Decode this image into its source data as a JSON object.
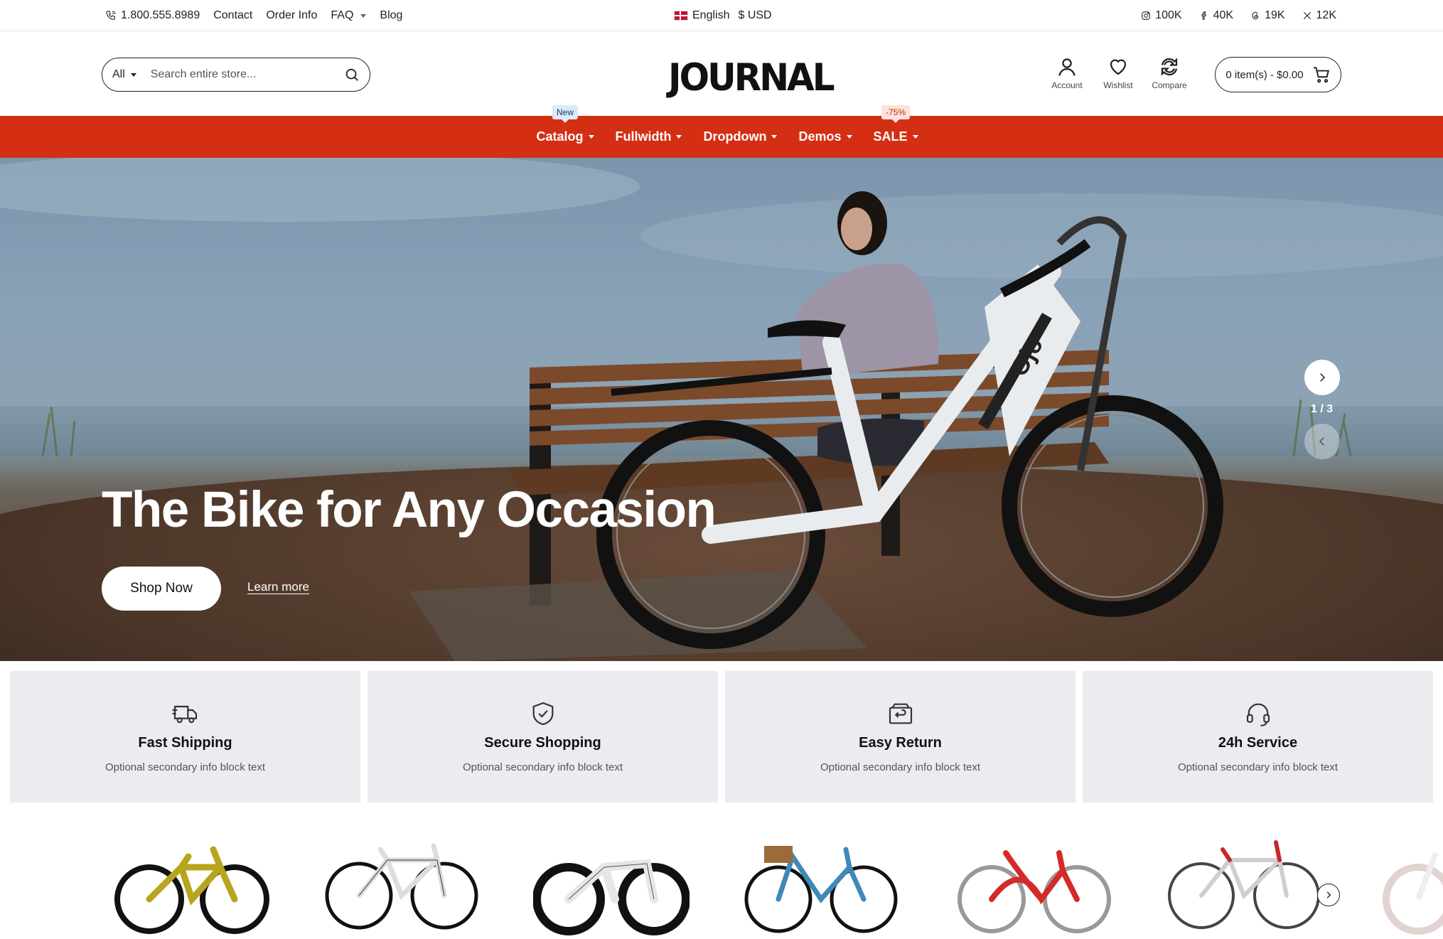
{
  "topbar": {
    "phone": "1.800.555.8989",
    "links": [
      "Contact",
      "Order Info",
      "FAQ",
      "Blog"
    ],
    "language": "English",
    "currency": "$ USD",
    "social": {
      "instagram": "100K",
      "facebook": "40K",
      "threads": "19K",
      "x": "12K"
    }
  },
  "header": {
    "search_category": "All",
    "search_placeholder": "Search entire store...",
    "logo": "JOURNAL",
    "account_label": "Account",
    "wishlist_label": "Wishlist",
    "compare_label": "Compare",
    "cart_label": "0 item(s) - $0.00"
  },
  "nav": {
    "items": [
      {
        "label": "Catalog",
        "badge": "New"
      },
      {
        "label": "Fullwidth",
        "badge": ""
      },
      {
        "label": "Dropdown",
        "badge": ""
      },
      {
        "label": "Demos",
        "badge": ""
      },
      {
        "label": "SALE",
        "badge": "-75%"
      }
    ]
  },
  "hero": {
    "title": "The Bike for Any Occasion",
    "primary_button": "Shop Now",
    "secondary_link": "Learn more",
    "slide_counter": "1 / 3",
    "bike_brand": "Ojo"
  },
  "info_blocks": [
    {
      "title": "Fast Shipping",
      "subtitle": "Optional secondary info block text",
      "icon": "truck-icon"
    },
    {
      "title": "Secure Shopping",
      "subtitle": "Optional secondary info block text",
      "icon": "shield-icon"
    },
    {
      "title": "Easy Return",
      "subtitle": "Optional secondary info block text",
      "icon": "return-icon"
    },
    {
      "title": "24h Service",
      "subtitle": "Optional secondary info block text",
      "icon": "headset-icon"
    }
  ],
  "colors": {
    "nav_bg": "#d42e13",
    "info_bg": "#ececf0"
  }
}
